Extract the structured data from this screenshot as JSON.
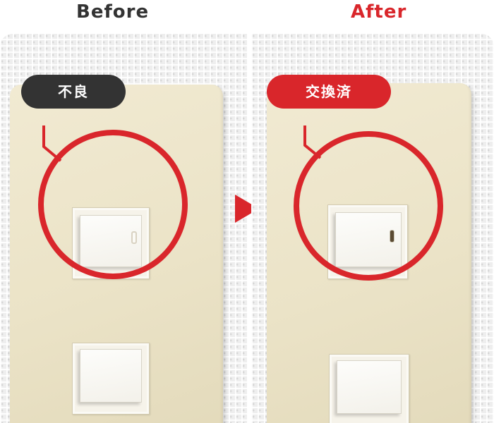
{
  "headings": {
    "before": "Before",
    "after": "After"
  },
  "labels": {
    "before": "不良",
    "after": "交換済"
  },
  "colors": {
    "accent_red": "#d9262b",
    "dark_label": "#333333",
    "plate": "#ebe3c7",
    "wall": "#eeeeee"
  },
  "icons": {
    "arrow": "play-triangle-right"
  }
}
